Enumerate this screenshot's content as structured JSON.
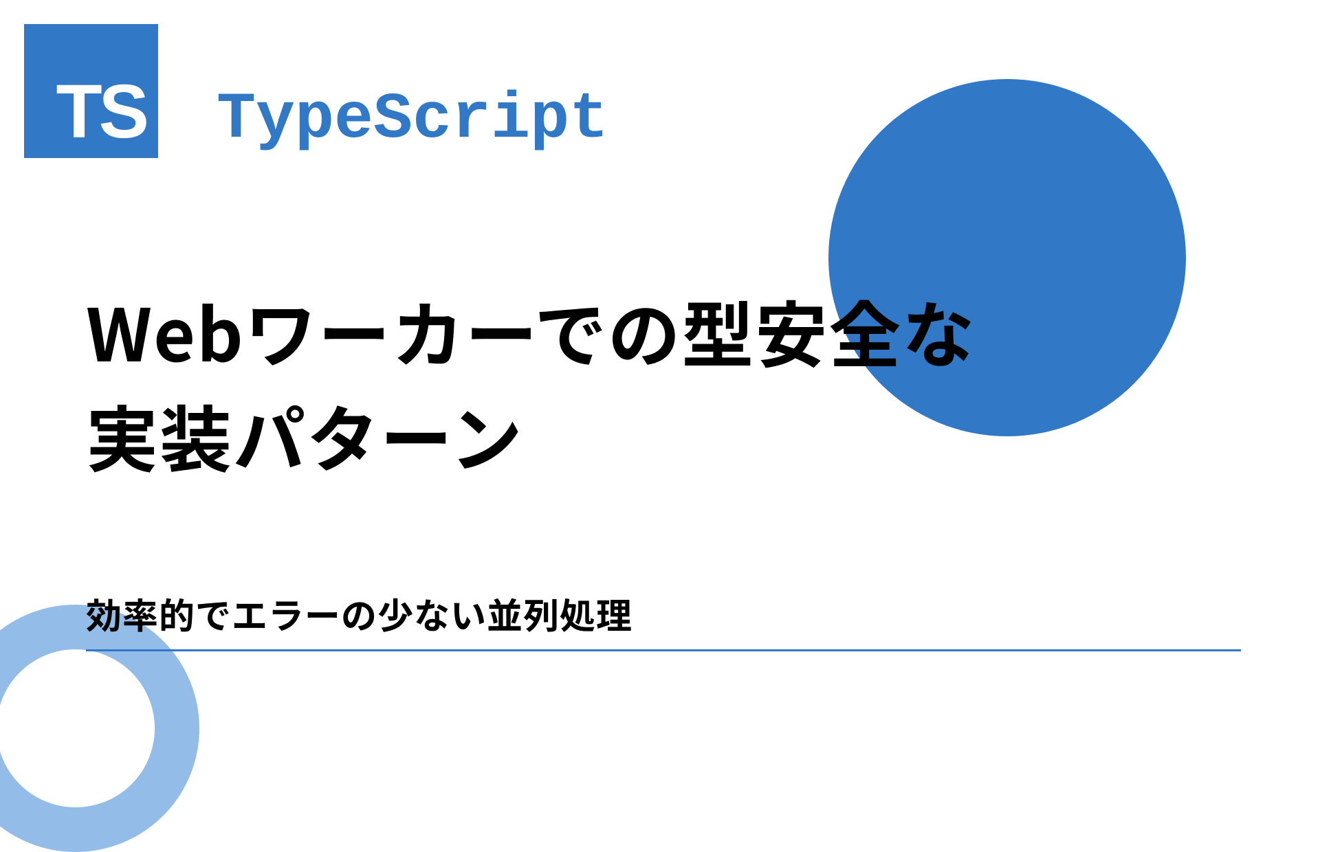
{
  "logo": {
    "text": "TS"
  },
  "label": "TypeScript",
  "title": "Webワーカーでの型安全な\n実装パターン",
  "subtitle": "効率的でエラーの少ない並列処理",
  "colors": {
    "brand": "#3178c6",
    "light": "#93bde8"
  }
}
